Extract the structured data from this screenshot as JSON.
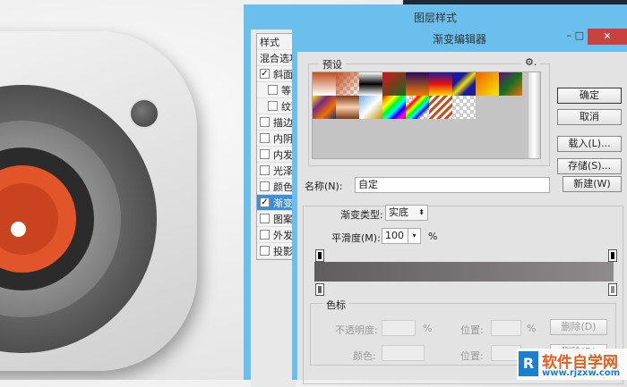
{
  "layer_style": {
    "title": "图层样式",
    "styles_header": "样式",
    "blend_options": "混合选项",
    "items": [
      {
        "label": "斜面和浮雕",
        "checked": true,
        "sub": false
      },
      {
        "label": "等高线",
        "checked": false,
        "sub": true
      },
      {
        "label": "纹理",
        "checked": false,
        "sub": true
      },
      {
        "label": "描边",
        "checked": false
      },
      {
        "label": "内阴影",
        "checked": false
      },
      {
        "label": "内发光",
        "checked": false
      },
      {
        "label": "光泽",
        "checked": false
      },
      {
        "label": "颜色叠加",
        "checked": false
      },
      {
        "label": "渐变叠加",
        "checked": true,
        "selected": true
      },
      {
        "label": "图案叠加",
        "checked": false
      },
      {
        "label": "外发光",
        "checked": false
      },
      {
        "label": "投影",
        "checked": false
      }
    ]
  },
  "editor": {
    "title": "渐变编辑器",
    "presets_label": "预设",
    "gear": "⚙.",
    "buttons": {
      "ok": "确定",
      "cancel": "取消",
      "load": "载入(L)...",
      "save": "存储(S)...",
      "new": "新建(W)"
    },
    "name_label": "名称(N):",
    "name_value": "自定",
    "type_label": "渐变类型:",
    "type_value": "实底",
    "smooth_label": "平滑度(M):",
    "smooth_value": "100",
    "percent": "%",
    "stops_label": "色标",
    "opacity_label": "不透明度:",
    "position_label": "位置:",
    "color_label": "颜色:",
    "delete": "删除(D)",
    "gradient": {
      "start": "#5f5d5e",
      "end": "#8f8a8b"
    }
  },
  "watermark": {
    "brand": "软件自学网",
    "url": "www.rjzxw.com"
  }
}
